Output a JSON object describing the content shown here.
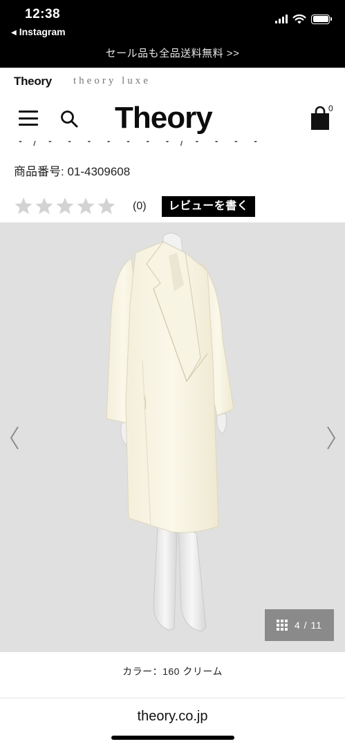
{
  "status_bar": {
    "time": "12:38",
    "back_label": "Instagram",
    "back_icon": "left-triangle-icon",
    "icons": [
      "signal-icon",
      "wifi-icon",
      "battery-icon"
    ]
  },
  "promo": {
    "text": "セール品も全品送料無料 >>"
  },
  "brand_tabs": {
    "theory": "Theory",
    "luxe": "theory luxe"
  },
  "header": {
    "logo": "Theory",
    "menu_icon": "hamburger-menu-icon",
    "search_icon": "search-icon",
    "cart_icon": "shopping-bag-icon",
    "cart_count": "0"
  },
  "product": {
    "number_label": "商品番号",
    "number_value": ": 01-4309608",
    "rating_stars": 0,
    "rating_max": 5,
    "review_count": "(0)",
    "review_button": "レビューを書く"
  },
  "gallery": {
    "image_subject": "cream long wool coat on mannequin",
    "prev_icon": "chevron-left-icon",
    "next_icon": "chevron-right-icon",
    "grid_icon": "grid-icon",
    "counter": "4 / 11",
    "background_color": "#e0e0e0"
  },
  "color_caption": "カラー：160 クリーム",
  "browser": {
    "url": "theory.co.jp"
  }
}
